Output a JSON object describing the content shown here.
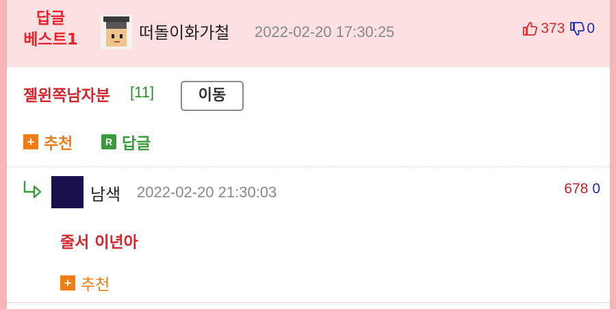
{
  "best_comment": {
    "label_line1": "답글",
    "label_line2": "베스트1",
    "nickname": "떠돌이화가철",
    "date": "2022-02-20 17:30:25",
    "upvotes": "373",
    "downvotes": "0"
  },
  "parent_comment": {
    "text": "젤윈쪽남자분",
    "reply_count": "[11]",
    "move_button": "이동",
    "recommend_label": "추천",
    "reply_label": "답글",
    "recommend_icon": "+",
    "reply_icon": "R"
  },
  "reply": {
    "nickname": "남색",
    "date": "2022-02-20 21:30:03",
    "upvotes": "678",
    "downvotes": "0",
    "text": "줄서 이년아",
    "recommend_label": "추천",
    "recommend_icon": "+"
  },
  "colors": {
    "accent_red": "#e8232b",
    "accent_orange": "#ef7d14",
    "accent_green": "#3b9a3b",
    "vote_blue": "#1d2bb8",
    "best_bg": "#fde0e1",
    "page_bg": "#f7b4b6"
  }
}
